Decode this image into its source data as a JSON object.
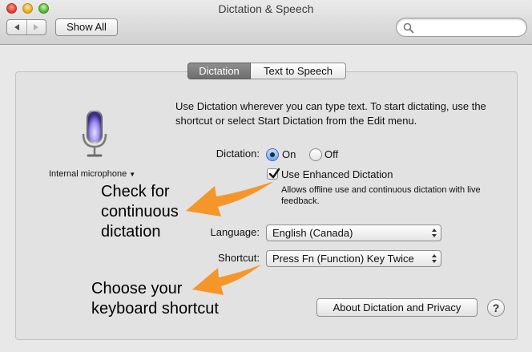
{
  "window": {
    "title": "Dictation & Speech",
    "show_all_label": "Show All"
  },
  "tabs": [
    {
      "label": "Dictation",
      "selected": true
    },
    {
      "label": "Text to Speech",
      "selected": false
    }
  ],
  "intro_text": "Use Dictation wherever you can type text. To start dictating, use the shortcut or select Start Dictation from the Edit menu.",
  "microphone": {
    "source_label": "Internal microphone",
    "icon": "microphone-icon"
  },
  "dictation": {
    "label": "Dictation:",
    "options": [
      {
        "label": "On",
        "selected": true
      },
      {
        "label": "Off",
        "selected": false
      }
    ]
  },
  "enhanced": {
    "checked": true,
    "label": "Use Enhanced Dictation",
    "help": "Allows offline use and continuous dictation with live feedback."
  },
  "language": {
    "label": "Language:",
    "value": "English (Canada)"
  },
  "shortcut": {
    "label": "Shortcut:",
    "value": "Press Fn (Function) Key Twice"
  },
  "about_button_label": "About Dictation and Privacy",
  "help_button_label": "?",
  "annotations": {
    "note1": [
      "Check for",
      "continuous",
      "dictation"
    ],
    "note2": [
      "Choose your",
      "keyboard shortcut"
    ],
    "arrow_color": "#f5962a"
  },
  "colors": {
    "selected_tab": "#7d7d7d",
    "radio_selected": "#6ea7ee",
    "mic_glow": "#9b8cf0"
  }
}
